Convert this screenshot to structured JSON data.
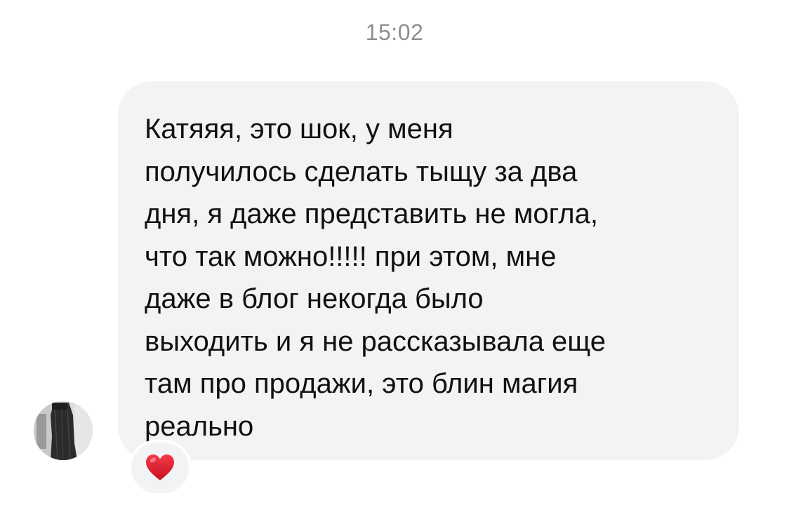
{
  "chat": {
    "timestamp": "15:02",
    "message": {
      "text": "Катяяя, это шок, у меня\nполучилось сделать тыщу за два\nдня, я даже представить не могла,\nчто так можно!!!!! при этом, мне\nдаже в блог некогда было\nвыходить и я не рассказывала еще\nтам про продажи, это блин магия\nреально",
      "bubble_color": "#f2f3f5",
      "text_color": "#111111"
    },
    "avatar": {
      "icon": "user-avatar-photo"
    },
    "reaction": {
      "icon": "red-heart-icon",
      "color": "#e0162b"
    }
  }
}
